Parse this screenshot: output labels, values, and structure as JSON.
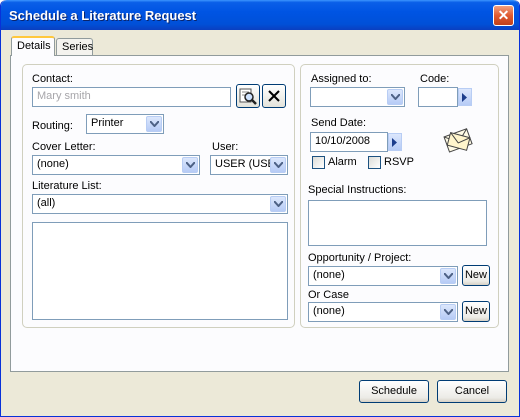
{
  "window": {
    "title": "Schedule a Literature Request",
    "close_glyph": "✕"
  },
  "tabs": [
    {
      "label": "Details"
    },
    {
      "label": "Series"
    }
  ],
  "left": {
    "contact_label": "Contact:",
    "contact_value": "Mary smith",
    "routing_label": "Routing:",
    "routing_value": "Printer",
    "cover_letter_label": "Cover Letter:",
    "cover_letter_value": "(none)",
    "user_label": "User:",
    "user_value": "USER (USER",
    "literature_list_label": "Literature List:",
    "literature_list_value": "(all)"
  },
  "right": {
    "assigned_to_label": "Assigned to:",
    "assigned_to_value": "",
    "code_label": "Code:",
    "code_value": "",
    "send_date_label": "Send Date:",
    "send_date_value": "10/10/2008",
    "alarm_label": "Alarm",
    "rsvp_label": "RSVP",
    "special_instructions_label": "Special Instructions:",
    "opportunity_label": "Opportunity / Project:",
    "opportunity_value": "(none)",
    "opportunity_new": "New",
    "or_case_label": "Or Case",
    "or_case_value": "(none)",
    "or_case_new": "New"
  },
  "footer": {
    "schedule_label": "Schedule",
    "cancel_label": "Cancel"
  },
  "colors": {
    "title_bar": "#0054e3",
    "dialog_bg": "#ece9d8",
    "field_border": "#7f9db9",
    "close_button": "#e05a30"
  },
  "icons": [
    "lookup-icon",
    "clear-x-icon",
    "dropdown-arrow-icon",
    "date-arrow-icon",
    "letters-icon"
  ]
}
